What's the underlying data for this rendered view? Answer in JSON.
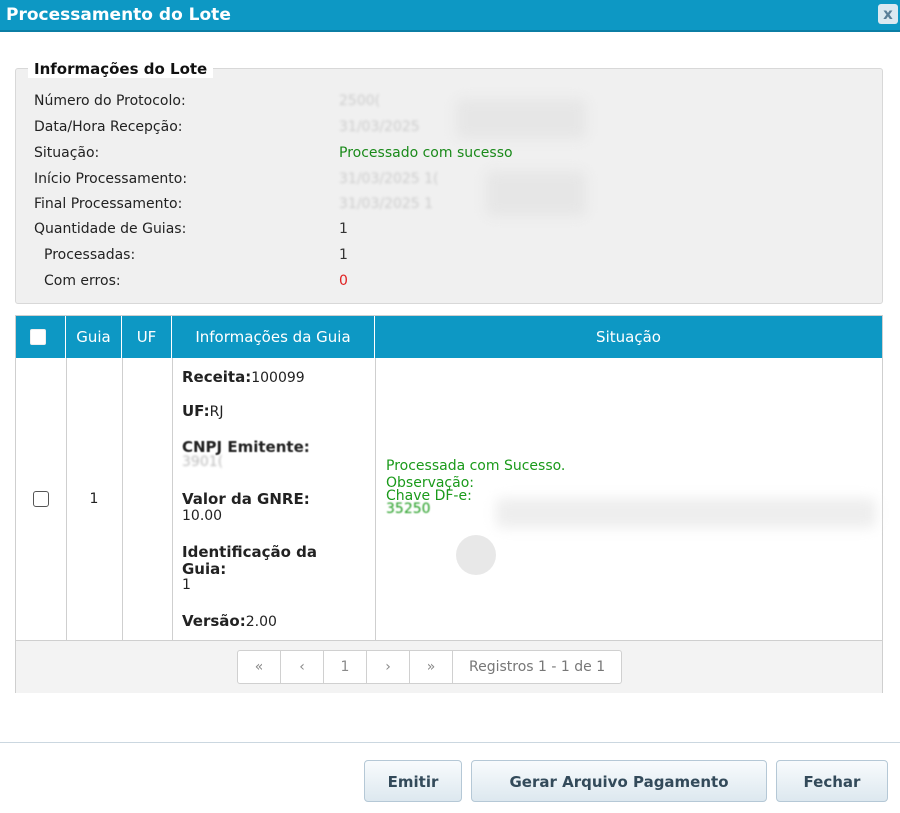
{
  "window": {
    "title": "Processamento do Lote",
    "close_glyph": "x"
  },
  "lote": {
    "legend": "Informações do Lote",
    "rows": [
      {
        "label": "Número do Protocolo:",
        "value": "2500("
      },
      {
        "label": "Data/Hora Recepção:",
        "value": "31/03/2025"
      },
      {
        "label": "Situação:",
        "value": "Processado com sucesso"
      },
      {
        "label": "Início Processamento:",
        "value": "31/03/2025 1("
      },
      {
        "label": "Final Processamento:",
        "value": "31/03/2025 1"
      },
      {
        "label": "Quantidade de Guias:",
        "value": "1"
      },
      {
        "label": "Processadas:",
        "value": "1"
      },
      {
        "label": "Com erros:",
        "value": "0"
      }
    ]
  },
  "table": {
    "headers": [
      "Guia",
      "UF",
      "Informações da Guia",
      "Situação"
    ],
    "row": {
      "guia": "1",
      "uf": "",
      "info": {
        "receita_label": "Receita:",
        "receita_value": "100099",
        "uf_label": "UF:",
        "uf_value": "RJ",
        "cnpj_label": "CNPJ Emitente:",
        "cnpj_value": "3901(",
        "valor_label": "Valor da GNRE:",
        "valor_value": "10.00",
        "ident_label_1": "Identificação da",
        "ident_label_2": "Guia:",
        "ident_value": "1",
        "versao_label": "Versão:",
        "versao_value": "2.00"
      },
      "situacao": {
        "line1": "Processada com Sucesso.",
        "line2": "Observação:",
        "line3": "Chave DF-e:",
        "line4": "35250"
      }
    },
    "pager": {
      "first": "«",
      "prev": "‹",
      "page": "1",
      "next": "›",
      "last": "»",
      "info": "Registros 1 - 1 de 1"
    }
  },
  "buttons": {
    "emitir": "Emitir",
    "gerar": "Gerar Arquivo Pagamento",
    "fechar": "Fechar"
  },
  "colors": {
    "header": "#0d98c4",
    "success": "#1a8a1a",
    "error": "#e02020"
  }
}
